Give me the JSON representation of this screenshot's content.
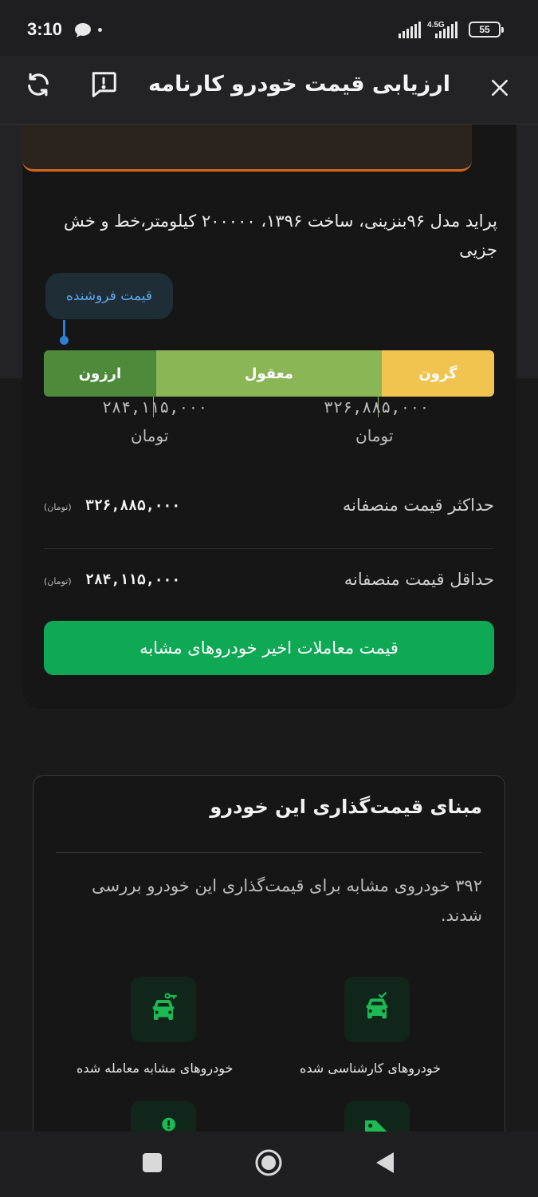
{
  "status_bar": {
    "time": "3:10",
    "network": "4.5G",
    "battery": "55"
  },
  "header": {
    "title": "ارزیابی قیمت خودرو کارنامه"
  },
  "car": {
    "description": "پراید مدل ۹۶بنزینی، ساخت ۱۳۹۶، ۲۰۰۰۰۰ کیلومتر،خط و خش جزیی"
  },
  "price_bar": {
    "seller_price_label": "قیمت فروشنده",
    "segments": {
      "cheap": "ارزون",
      "fair": "معقول",
      "expensive": "گرون"
    },
    "lower_bound": "۲۸۴,۱۱۵,۰۰۰",
    "upper_bound": "۳۲۶,۸۸۵,۰۰۰",
    "unit": "تومان"
  },
  "fair_price": {
    "max_label": "حداکثر قیمت منصفانه",
    "max_value": "۳۲۶,۸۸۵,۰۰۰",
    "min_label": "حداقل قیمت منصفانه",
    "min_value": "۲۸۴,۱۱۵,۰۰۰",
    "unit": "(تومان)"
  },
  "cta": {
    "label": "قیمت معاملات اخیر خودروهای مشابه"
  },
  "basis": {
    "title": "مبنای قیمت‌گذاری این خودرو",
    "text": "۳۹۲ خودروی مشابه برای قیمت‌گذاری این خودرو بررسی شدند.",
    "features": [
      {
        "label": "خودروهای کارشناسی شده"
      },
      {
        "label": "خودروهای مشابه معامله شده"
      }
    ]
  },
  "colors": {
    "cheap": "#4d8a3a",
    "fair": "#8ab656",
    "expensive": "#f0c44e",
    "cta": "#0fa854",
    "seller_marker": "#2f7fd6"
  }
}
